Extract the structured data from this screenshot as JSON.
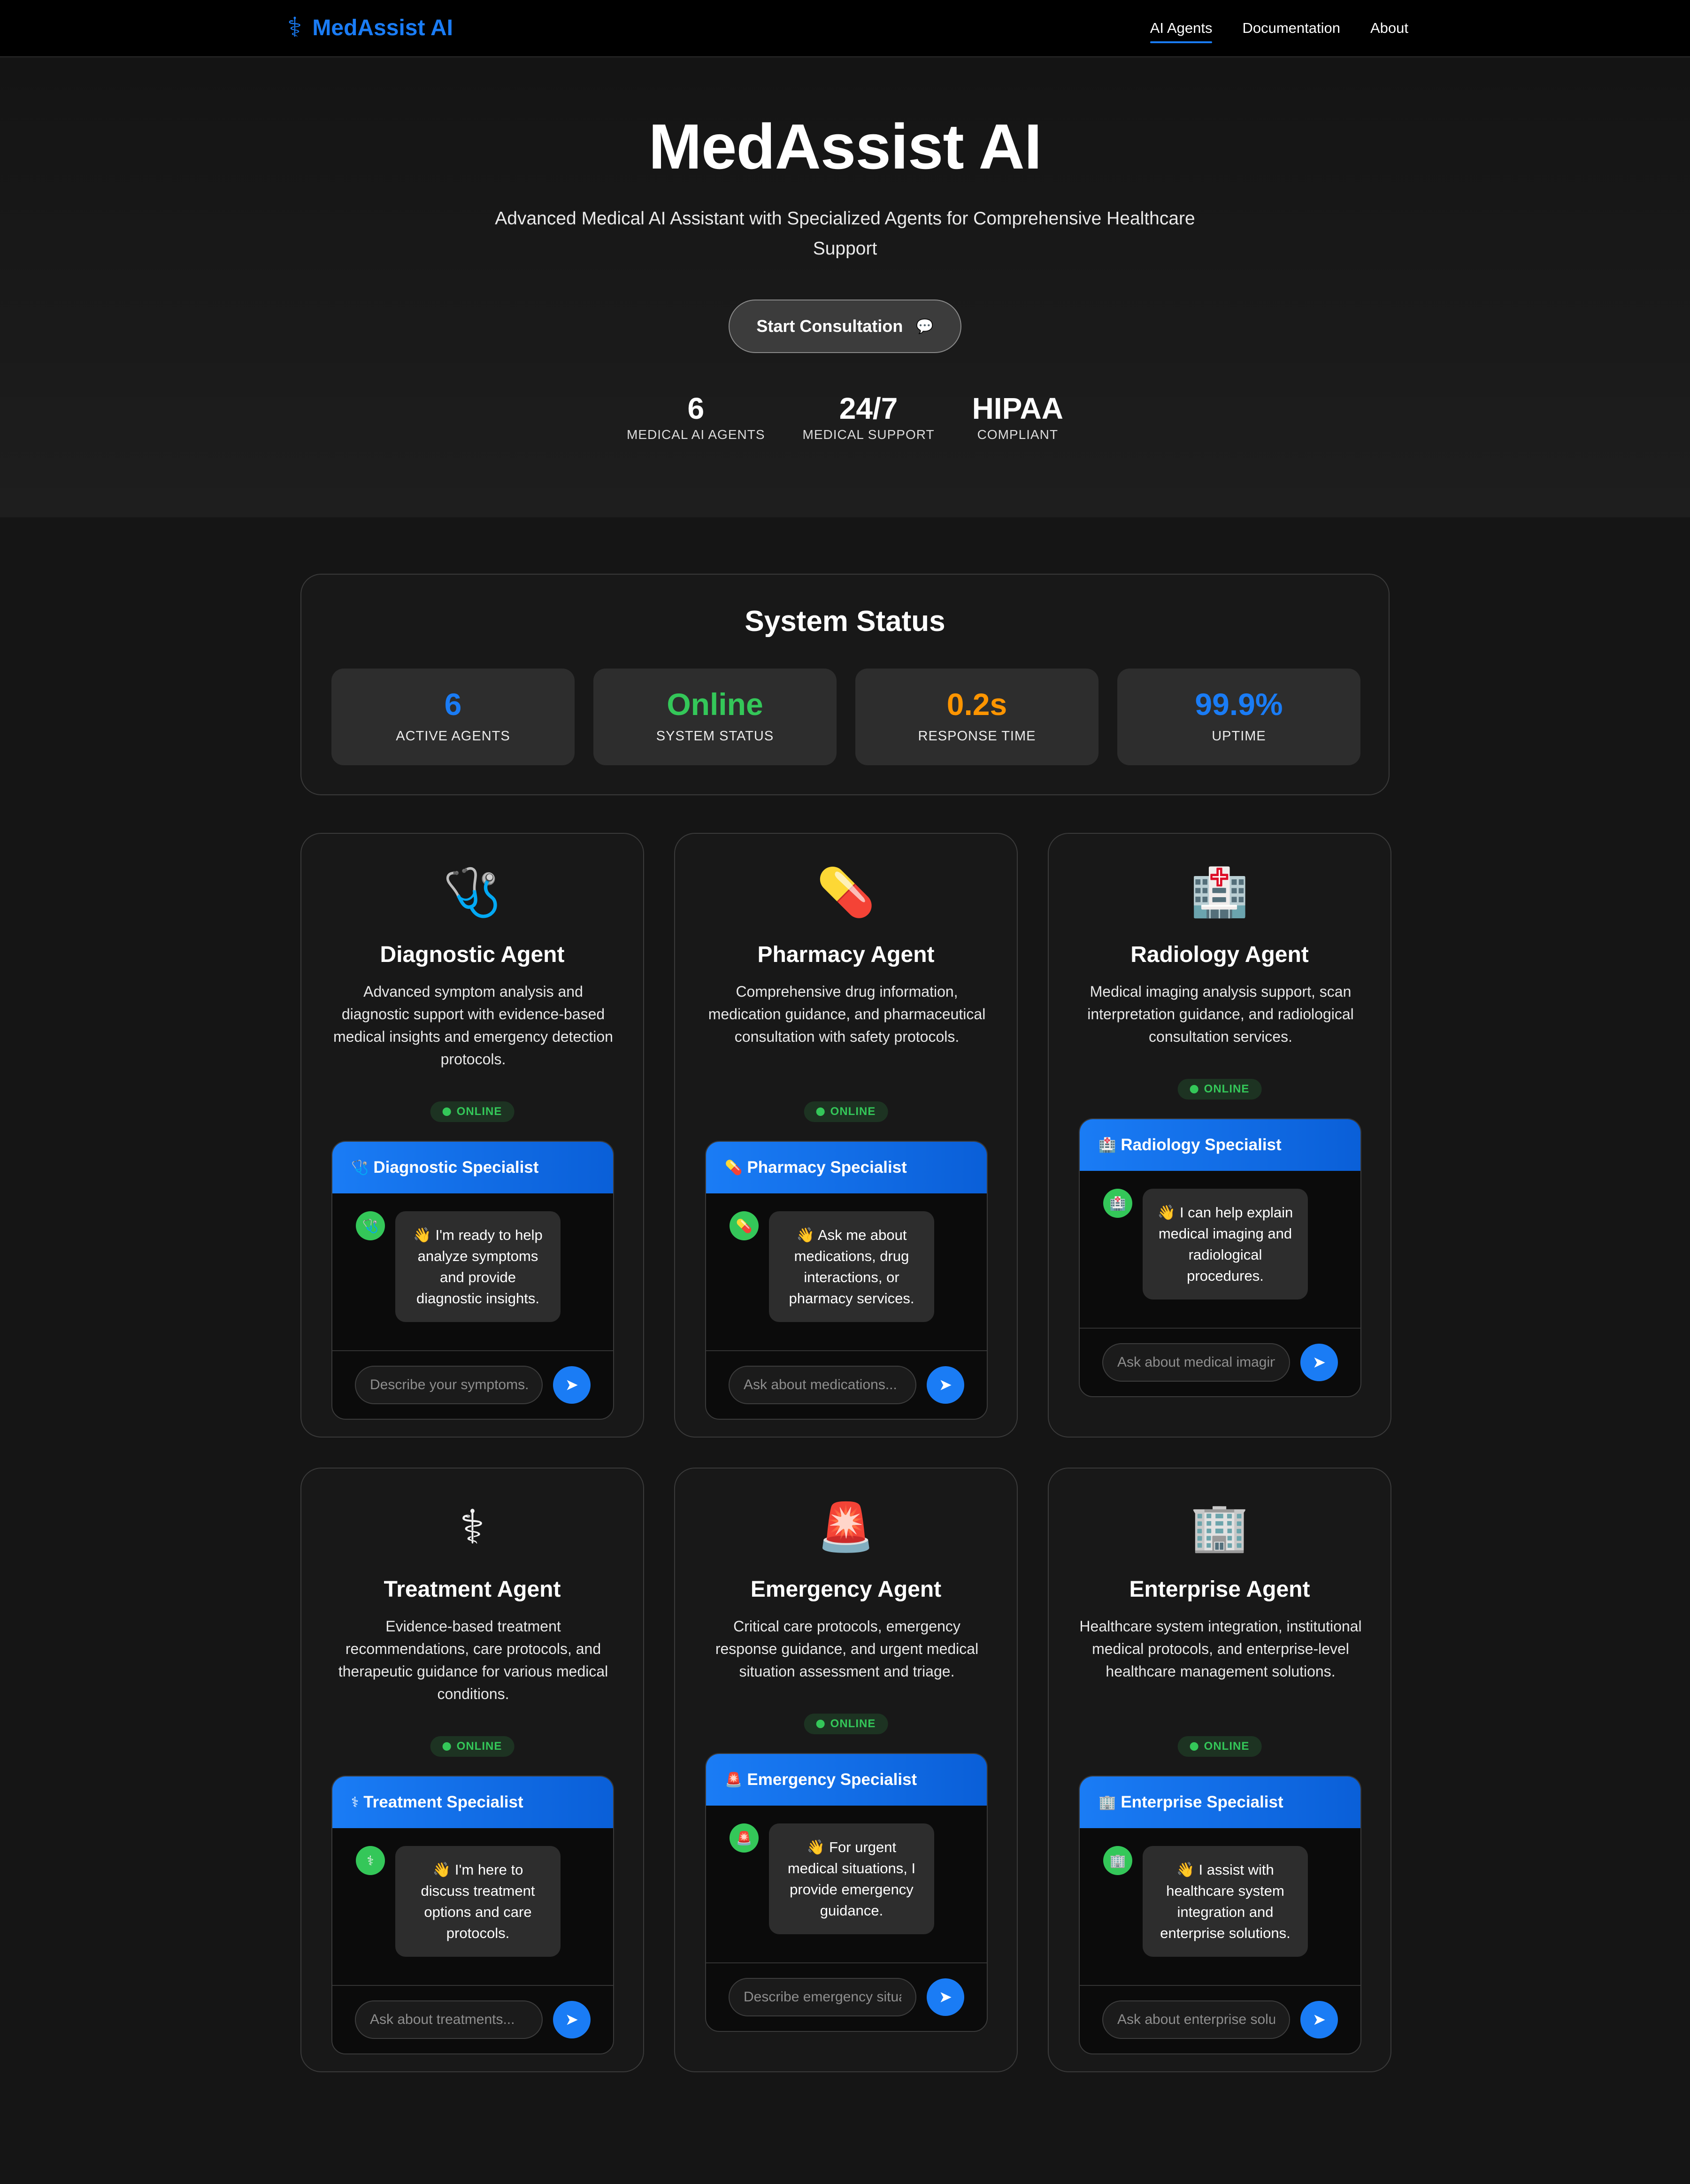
{
  "nav": {
    "brand_icon": "caduceus-icon",
    "brand": "MedAssist AI",
    "links": [
      "AI Agents",
      "Documentation",
      "About"
    ],
    "active_link": "AI Agents"
  },
  "hero": {
    "title": "MedAssist AI",
    "subtitle": "Advanced Medical AI Assistant with Specialized Agents for Comprehensive Healthcare Support",
    "cta_label": "Start Consultation",
    "cta_icon": "💬",
    "stats": [
      {
        "value": "6",
        "label": "MEDICAL AI AGENTS"
      },
      {
        "value": "24/7",
        "label": "MEDICAL SUPPORT"
      },
      {
        "value": "HIPAA",
        "label": "COMPLIANT"
      }
    ]
  },
  "status": {
    "title": "System Status",
    "cards": [
      {
        "value": "6",
        "label": "ACTIVE AGENTS",
        "color": "#1a7cf5"
      },
      {
        "value": "Online",
        "label": "SYSTEM STATUS",
        "color": "#34c759"
      },
      {
        "value": "0.2s",
        "label": "RESPONSE TIME",
        "color": "#ff9500"
      },
      {
        "value": "99.9%",
        "label": "UPTIME",
        "color": "#1a7cf5"
      }
    ]
  },
  "agents": [
    {
      "icon": "🩺",
      "name": "Diagnostic Agent",
      "description": "Advanced symptom analysis and diagnostic support with evidence-based medical insights and emergency detection protocols.",
      "status": "ONLINE",
      "chat_title": "Diagnostic Specialist",
      "chat_icon": "🩺",
      "avatar": "🩺",
      "message": "👋 I'm ready to help analyze symptoms and provide diagnostic insights.",
      "placeholder": "Describe your symptoms..."
    },
    {
      "icon": "💊",
      "name": "Pharmacy Agent",
      "description": "Comprehensive drug information, medication guidance, and pharmaceutical consultation with safety protocols.",
      "status": "ONLINE",
      "chat_title": "Pharmacy Specialist",
      "chat_icon": "💊",
      "avatar": "💊",
      "message": "👋 Ask me about medications, drug interactions, or pharmacy services.",
      "placeholder": "Ask about medications..."
    },
    {
      "icon": "🏥",
      "name": "Radiology Agent",
      "description": "Medical imaging analysis support, scan interpretation guidance, and radiological consultation services.",
      "status": "ONLINE",
      "chat_title": "Radiology Specialist",
      "chat_icon": "🏥",
      "avatar": "🏥",
      "message": "👋 I can help explain medical imaging and radiological procedures.",
      "placeholder": "Ask about medical imaging..."
    },
    {
      "icon": "⚕",
      "name": "Treatment Agent",
      "description": "Evidence-based treatment recommendations, care protocols, and therapeutic guidance for various medical conditions.",
      "status": "ONLINE",
      "chat_title": "Treatment Specialist",
      "chat_icon": "⚕",
      "avatar": "⚕",
      "message": "👋 I'm here to discuss treatment options and care protocols.",
      "placeholder": "Ask about treatments..."
    },
    {
      "icon": "🚨",
      "name": "Emergency Agent",
      "description": "Critical care protocols, emergency response guidance, and urgent medical situation assessment and triage.",
      "status": "ONLINE",
      "chat_title": "Emergency Specialist",
      "chat_icon": "🚨",
      "avatar": "🚨",
      "message": "👋 For urgent medical situations, I provide emergency guidance.",
      "placeholder": "Describe emergency situation..."
    },
    {
      "icon": "🏢",
      "name": "Enterprise Agent",
      "description": "Healthcare system integration, institutional medical protocols, and enterprise-level healthcare management solutions.",
      "status": "ONLINE",
      "chat_title": "Enterprise Specialist",
      "chat_icon": "🏢",
      "avatar": "🏢",
      "message": "👋 I assist with healthcare system integration and enterprise solutions.",
      "placeholder": "Ask about enterprise solutions..."
    }
  ]
}
